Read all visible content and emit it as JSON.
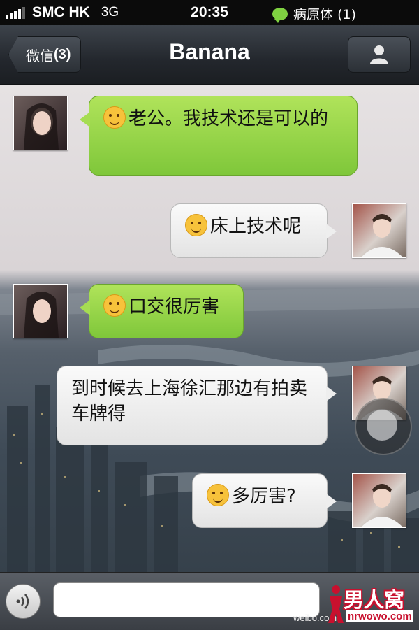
{
  "status_bar": {
    "carrier": "SMC HK",
    "network": "3G",
    "time": "20:35",
    "notification": "病原体 (1)",
    "signal_icon": "signal-bars-icon",
    "notif_icon": "wechat-bubble-icon"
  },
  "nav": {
    "back_label": "微信",
    "back_badge": "(3)",
    "title": "Banana",
    "profile_icon": "person-icon"
  },
  "messages": [
    {
      "side": "left",
      "text": "老公。我技术还是可以的",
      "emoji": "blushing-face",
      "color": "green"
    },
    {
      "side": "right",
      "text": "床上技术呢",
      "emoji": "grinning-face",
      "color": "white"
    },
    {
      "side": "left",
      "text": "口交很厉害",
      "emoji": "blushing-face",
      "color": "green"
    },
    {
      "side": "right",
      "text": "到时候去上海徐汇那边有拍卖车牌得",
      "emoji": "",
      "color": "white"
    },
    {
      "side": "right",
      "text": "多厉害?",
      "emoji": "thinking-face",
      "color": "white"
    }
  ],
  "input": {
    "value": "",
    "placeholder": "",
    "voice_icon": "voice-icon"
  },
  "watermark": {
    "weibo": "weibo.com",
    "site_cn": "男人窝",
    "site_en": "nrwowo.com"
  },
  "colors": {
    "bubble_green": "#8fd13f",
    "bubble_white": "#f0f0f0",
    "nav_bg": "#2b3036",
    "watermark_red": "#c8102e"
  }
}
